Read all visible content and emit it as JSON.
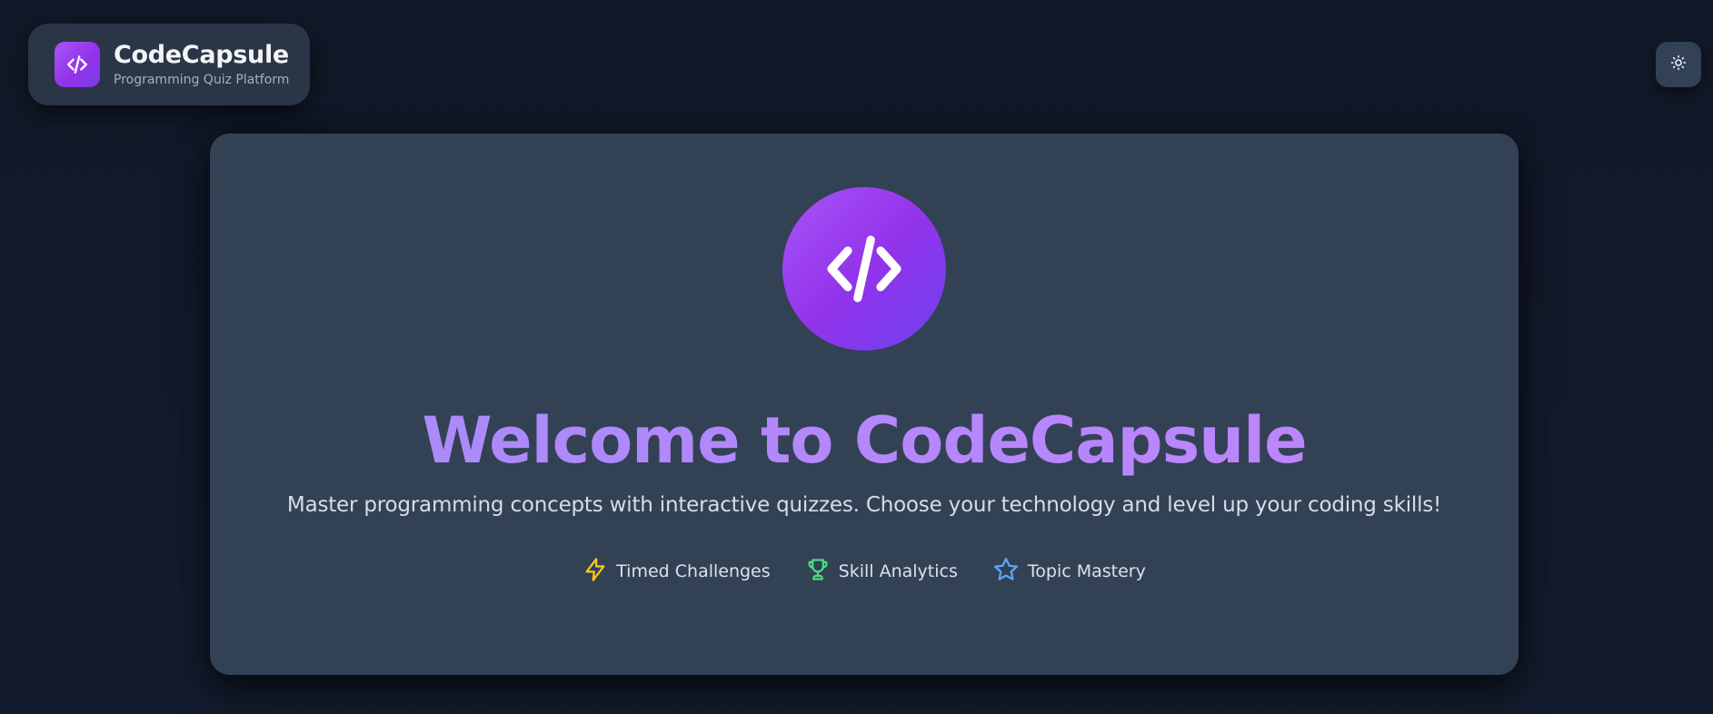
{
  "brand": {
    "title": "CodeCapsule",
    "subtitle": "Programming Quiz Platform",
    "logo_icon": "code-icon"
  },
  "header": {
    "theme_toggle_icon": "sun-icon"
  },
  "hero": {
    "icon": "code-icon",
    "title": "Welcome to CodeCapsule",
    "description": "Master programming concepts with interactive quizzes. Choose your technology and level up your coding skills!",
    "features": [
      {
        "label": "Timed Challenges",
        "icon": "lightning-icon",
        "color": "#facc15"
      },
      {
        "label": "Skill Analytics",
        "icon": "trophy-icon",
        "color": "#4ade80"
      },
      {
        "label": "Topic Mastery",
        "icon": "star-icon",
        "color": "#60a5fa"
      }
    ]
  },
  "colors": {
    "background": "#111827",
    "card": "#334155",
    "accent": "#a855f7",
    "title": "#b388f5"
  }
}
